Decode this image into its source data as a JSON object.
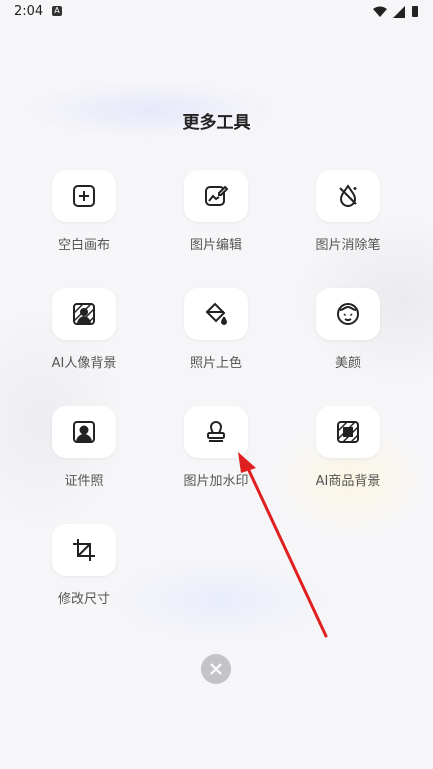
{
  "status_bar": {
    "time": "2:04"
  },
  "title": "更多工具",
  "tools": [
    {
      "label": "空白画布",
      "icon": "plus-square-icon"
    },
    {
      "label": "图片编辑",
      "icon": "image-edit-icon"
    },
    {
      "label": "图片消除笔",
      "icon": "eraser-icon"
    },
    {
      "label": "AI人像背景",
      "icon": "portrait-background-icon"
    },
    {
      "label": "照片上色",
      "icon": "paint-bucket-icon"
    },
    {
      "label": "美颜",
      "icon": "face-beauty-icon"
    },
    {
      "label": "证件照",
      "icon": "id-photo-icon"
    },
    {
      "label": "图片加水印",
      "icon": "stamp-icon"
    },
    {
      "label": "AI商品背景",
      "icon": "product-background-icon"
    },
    {
      "label": "修改尺寸",
      "icon": "crop-icon"
    }
  ],
  "colors": {
    "arrow": "#e02020",
    "close_button": "#c4c4c8"
  }
}
